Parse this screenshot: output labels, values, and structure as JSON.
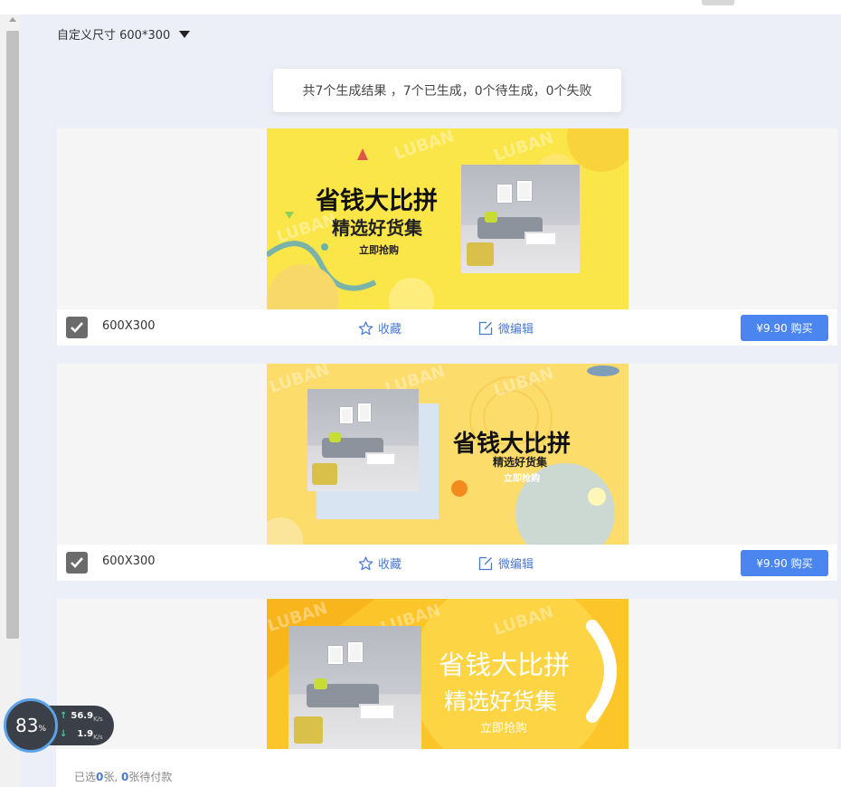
{
  "header": {
    "size_select": "自定义尺寸 600*300"
  },
  "summary": "共7个生成结果 ，7个已生成，0个待生成，0个失败",
  "cards": [
    {
      "size": "600X300",
      "favorite": "收藏",
      "edit": "微编辑",
      "price": "¥9.90  购买",
      "banner": {
        "headline": "省钱大比拼",
        "subline": "精选好货集",
        "cta": "立即抢购",
        "watermark": "LUBAN",
        "bg_color": "#fbe64a"
      }
    },
    {
      "size": "600X300",
      "favorite": "收藏",
      "edit": "微编辑",
      "price": "¥9.90  购买",
      "banner": {
        "headline": "省钱大比拼",
        "subline": "精选好货集",
        "cta": "立即抢购",
        "watermark": "LUBAN",
        "bg_color": "#fcdc6a"
      }
    },
    {
      "banner": {
        "headline": "省钱大比拼",
        "subline": "精选好货集",
        "cta": "立即抢购",
        "watermark": "LUBAN",
        "bg_color": "#fcc62a"
      }
    }
  ],
  "footer": {
    "prefix": "已选",
    "selected_count": "0",
    "mid": "张, ",
    "pending_count": "0",
    "suffix": "张待付款"
  },
  "speed_widget": {
    "percent": "83",
    "percent_unit": "%",
    "upload": "56.9",
    "download": "1.9",
    "unit": "K/s"
  },
  "colors": {
    "accent": "#4a85f0",
    "link": "#4a7ad0",
    "page_bg": "#eceff7"
  }
}
